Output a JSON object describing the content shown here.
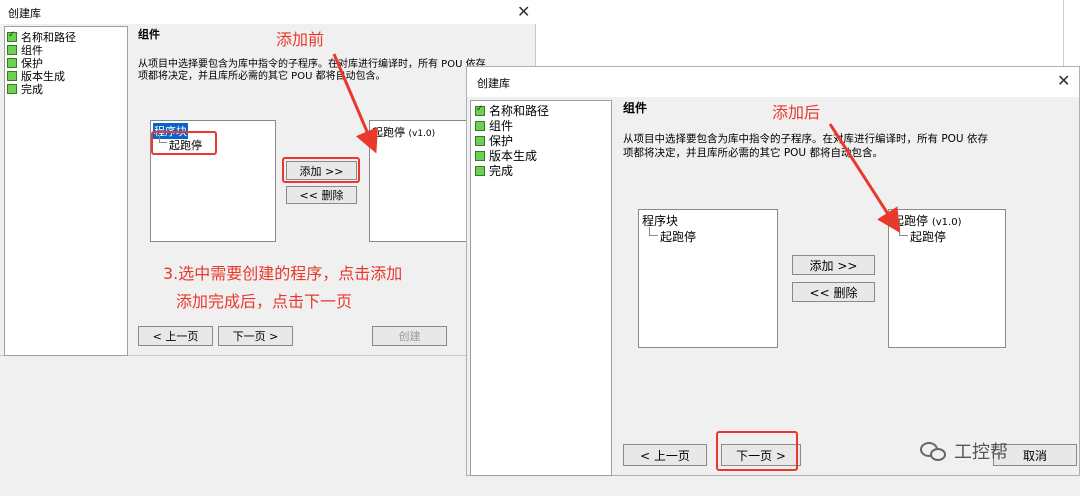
{
  "dialog1": {
    "title": "创建库",
    "nav": [
      {
        "label": "名称和路径",
        "checked": true
      },
      {
        "label": "组件",
        "checked": false
      },
      {
        "label": "保护",
        "checked": false
      },
      {
        "label": "版本生成",
        "checked": false
      },
      {
        "label": "完成",
        "checked": false
      }
    ],
    "section_title": "组件",
    "description_line1": "从项目中选择要包含为库中指令的子程序。在对库进行编译时，所有 POU 依存",
    "description_line2": "项都将决定，并且库所必需的其它 POU 都将自动包含。",
    "left_list": {
      "root": "程序块",
      "child": "起跑停"
    },
    "right_list": {
      "root": "起跑停",
      "root_version": "(v1.0)"
    },
    "add_button": "添加 >>",
    "remove_button": "<< 删除",
    "prev_button": "< 上一页",
    "next_button": "下一页 >",
    "create_button": "创建"
  },
  "dialog2": {
    "title": "创建库",
    "nav": [
      {
        "label": "名称和路径",
        "checked": true
      },
      {
        "label": "组件",
        "checked": false
      },
      {
        "label": "保护",
        "checked": false
      },
      {
        "label": "版本生成",
        "checked": false
      },
      {
        "label": "完成",
        "checked": false
      }
    ],
    "section_title": "组件",
    "description_line1": "从项目中选择要包含为库中指令的子程序。在对库进行编译时，所有 POU 依存",
    "description_line2": "项都将决定，并且库所必需的其它 POU 都将自动包含。",
    "left_list": {
      "root": "程序块",
      "child": "起跑停"
    },
    "right_list": {
      "root": "起跑停",
      "root_version": "(v1.0)",
      "child": "起跑停"
    },
    "add_button": "添加 >>",
    "remove_button": "<< 删除",
    "prev_button": "< 上一页",
    "next_button": "下一页 >",
    "cancel_button": "取消"
  },
  "annotations": {
    "before": "添加前",
    "after": "添加后",
    "instruction_line1": "3.选中需要创建的程序，点击添加",
    "instruction_line2": "添加完成后，点击下一页"
  },
  "watermark": "工控帮",
  "colors": {
    "annotation_red": "#e8392c",
    "check_green": "#6fcf54",
    "selection_blue": "#0a64c8"
  }
}
